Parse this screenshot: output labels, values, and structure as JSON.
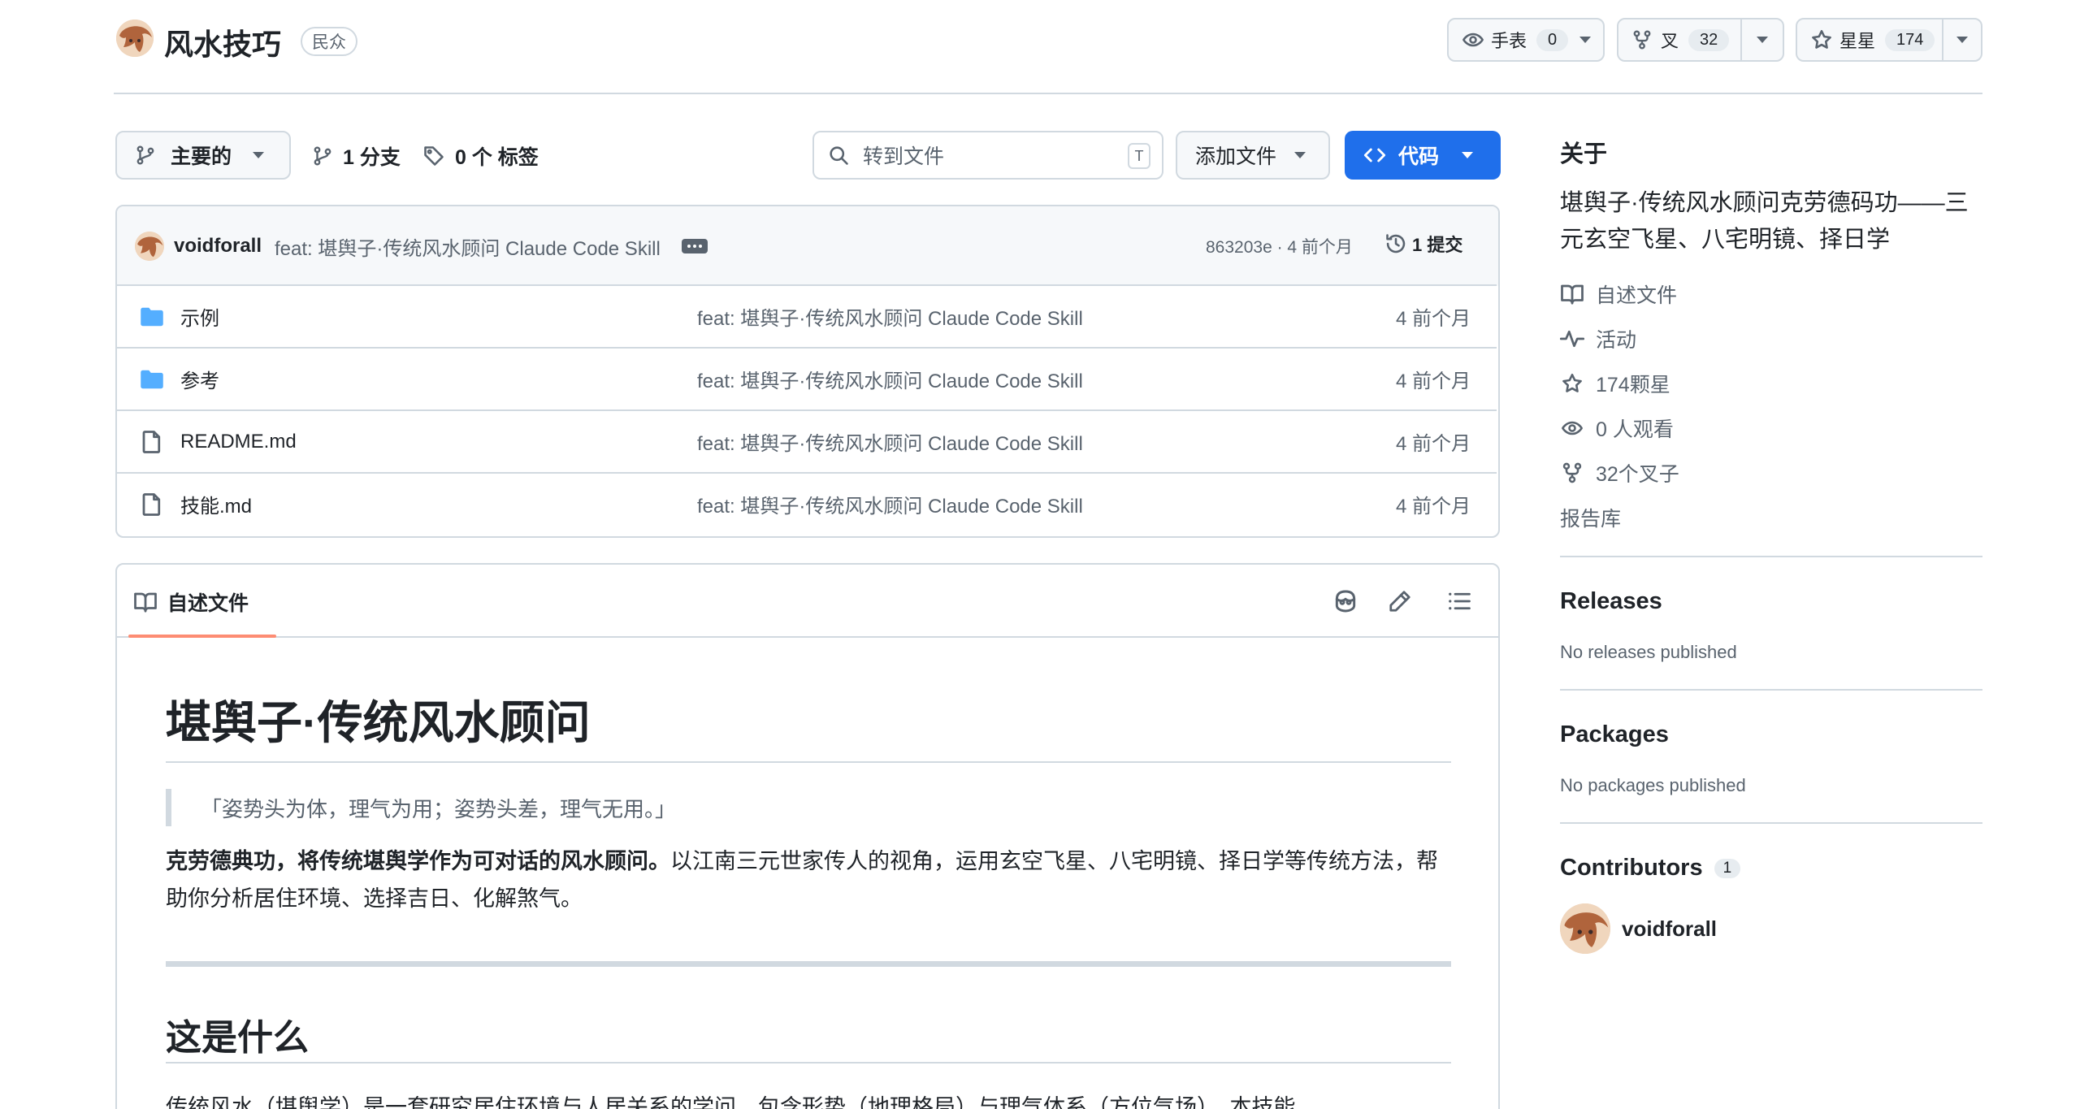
{
  "repo": {
    "name": "风水技巧",
    "visibility": "民众"
  },
  "actions": {
    "watch": {
      "label": "手表",
      "count": "0"
    },
    "fork": {
      "label": "叉",
      "count": "32"
    },
    "star": {
      "label": "星星",
      "count": "174"
    }
  },
  "branch_bar": {
    "branch": "主要的",
    "branches": "1 分支",
    "tags": "0 个 标签",
    "goto_placeholder": "转到文件",
    "goto_shortcut": "T",
    "add_file": "添加文件",
    "code": "代码"
  },
  "commit": {
    "author": "voidforall",
    "message": "feat: 堪舆子·传统风水顾问 Claude Code Skill",
    "hash_time": "863203e · 4 前个月",
    "commits": "1 提交"
  },
  "files": [
    {
      "name": "示例",
      "type": "folder",
      "message": "feat: 堪舆子·传统风水顾问 Claude Code Skill",
      "time": "4 前个月"
    },
    {
      "name": "参考",
      "type": "folder",
      "message": "feat: 堪舆子·传统风水顾问 Claude Code Skill",
      "time": "4 前个月"
    },
    {
      "name": "README.md",
      "type": "file",
      "message": "feat: 堪舆子·传统风水顾问 Claude Code Skill",
      "time": "4 前个月"
    },
    {
      "name": "技能.md",
      "type": "file",
      "message": "feat: 堪舆子·传统风水顾问 Claude Code Skill",
      "time": "4 前个月"
    }
  ],
  "readme": {
    "tab": "自述文件",
    "h1": "堪舆子·传统风水顾问",
    "quote": "「姿势头为体，理气为用；姿势头差，理气无用。」",
    "intro_bold": "克劳德典功，将传统堪舆学作为可对话的风水顾问。",
    "intro_rest": "以江南三元世家传人的视角，运用玄空飞星、八宅明镜、择日学等传统方法，帮助你分析居住环境、选择吉日、化解煞气。",
    "h2": "这是什么",
    "para": "传统风水（堪舆学）是一套研究居住环境与人居关系的学问，包含形势（地理格局）与理气体系（方位气场）。本技能"
  },
  "about": {
    "title": "关于",
    "description": "堪舆子·传统风水顾问克劳德码功——三元玄空飞星、八宅明镜、择日学",
    "items": {
      "readme": "自述文件",
      "activity": "活动",
      "stars": "174颗星",
      "watching": "0 人观看",
      "forks": "32个叉子",
      "report": "报告库"
    }
  },
  "releases": {
    "title": "Releases",
    "note": "No releases published"
  },
  "packages": {
    "title": "Packages",
    "note": "No packages published"
  },
  "contributors": {
    "title": "Contributors",
    "count": "1",
    "name": "voidforall"
  },
  "colors": {
    "primary": "#1f6feb",
    "border": "#d1d9e0",
    "tab_underline": "#fd8c73",
    "folder": "#54aeff"
  }
}
